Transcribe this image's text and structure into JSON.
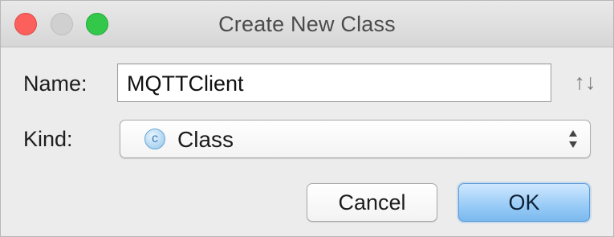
{
  "window": {
    "title": "Create New Class",
    "controls": {
      "close_color": "#fc605c",
      "minimize_color": "#d0d0d0",
      "zoom_color": "#34c84a"
    }
  },
  "form": {
    "name_label": "Name:",
    "name_value": "MQTTClient",
    "sort_icon": "up-down-arrows-icon",
    "sort_glyph": "↑↓",
    "kind_label": "Kind:",
    "kind_value": "Class",
    "kind_icon": "class-badge-icon",
    "kind_icon_letter": "c"
  },
  "buttons": {
    "cancel_label": "Cancel",
    "ok_label": "OK"
  },
  "colors": {
    "default_button": "#9ccdf7",
    "window_background": "#ececec"
  }
}
